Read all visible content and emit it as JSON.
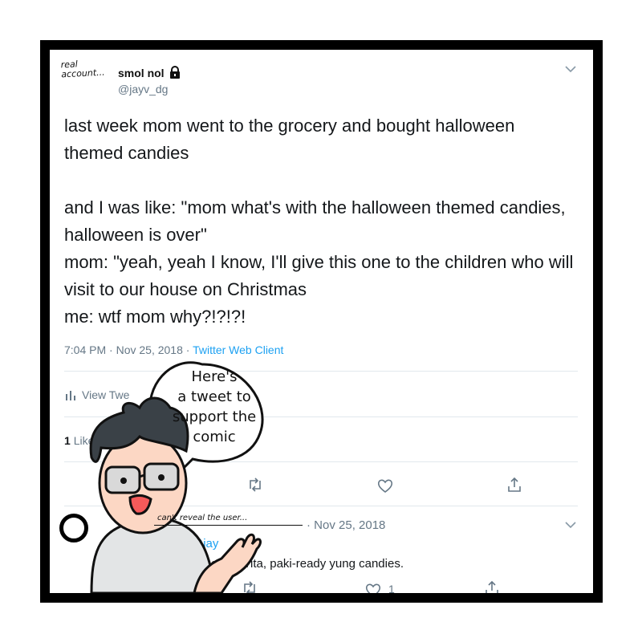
{
  "tweet": {
    "note": [
      "real",
      "account..."
    ],
    "name": "smol nol",
    "handle": "@jayv_dg",
    "paragraphs": [
      "last week mom went to the grocery and bought halloween themed candies",
      "",
      "and I was like: \"mom what's with the halloween themed candies, halloween is over\"",
      "mom: \"yeah, yeah I know, I'll give this one to the children who will visit to our house on Christmas",
      "me: wtf mom why?!?!?!"
    ],
    "time": "7:04 PM · Nov 25, 2018 · ",
    "client": "Twitter Web Client",
    "activity_label": "View Twe",
    "likes_count": "1",
    "likes_label": "Like",
    "icons": [
      "chevron-down-icon",
      "lock-icon",
      "activity-icon",
      "retweet-icon",
      "heart-icon",
      "share-icon"
    ]
  },
  "reply": {
    "time": "· Nov 25, 2018",
    "handle": "@jay",
    "text": "o     house. Tita, paki-ready yung candies.",
    "like_count": "1"
  },
  "comic": {
    "bubble": [
      "Here's",
      "a tweet to",
      "support the",
      "comic"
    ],
    "caption": "can't reveal the user..."
  },
  "colors": {
    "link": "#1da1f2",
    "muted": "#657786",
    "text": "#14171a",
    "frame": "#000000",
    "skin": "#fcd7c4",
    "shirt": "#e3e5e6"
  }
}
